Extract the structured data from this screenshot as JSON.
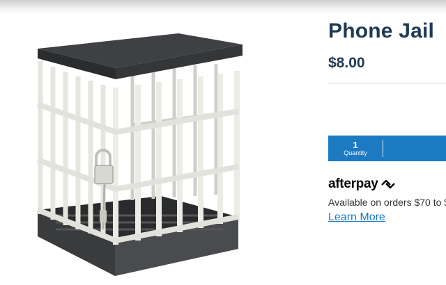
{
  "product": {
    "title": "Phone Jail",
    "price": "$8.00",
    "image_icon": "phone-jail-cage-image"
  },
  "quantity": {
    "value": "1",
    "label": "Quantity"
  },
  "afterpay": {
    "logo_text": "afterpay",
    "logo_icon": "afterpay-arrows-icon",
    "note": "Available on orders $70 to $",
    "link_label": "Learn More"
  },
  "colors": {
    "heading": "#1e3a54",
    "accent": "#1b7ac1",
    "text": "#333333"
  }
}
